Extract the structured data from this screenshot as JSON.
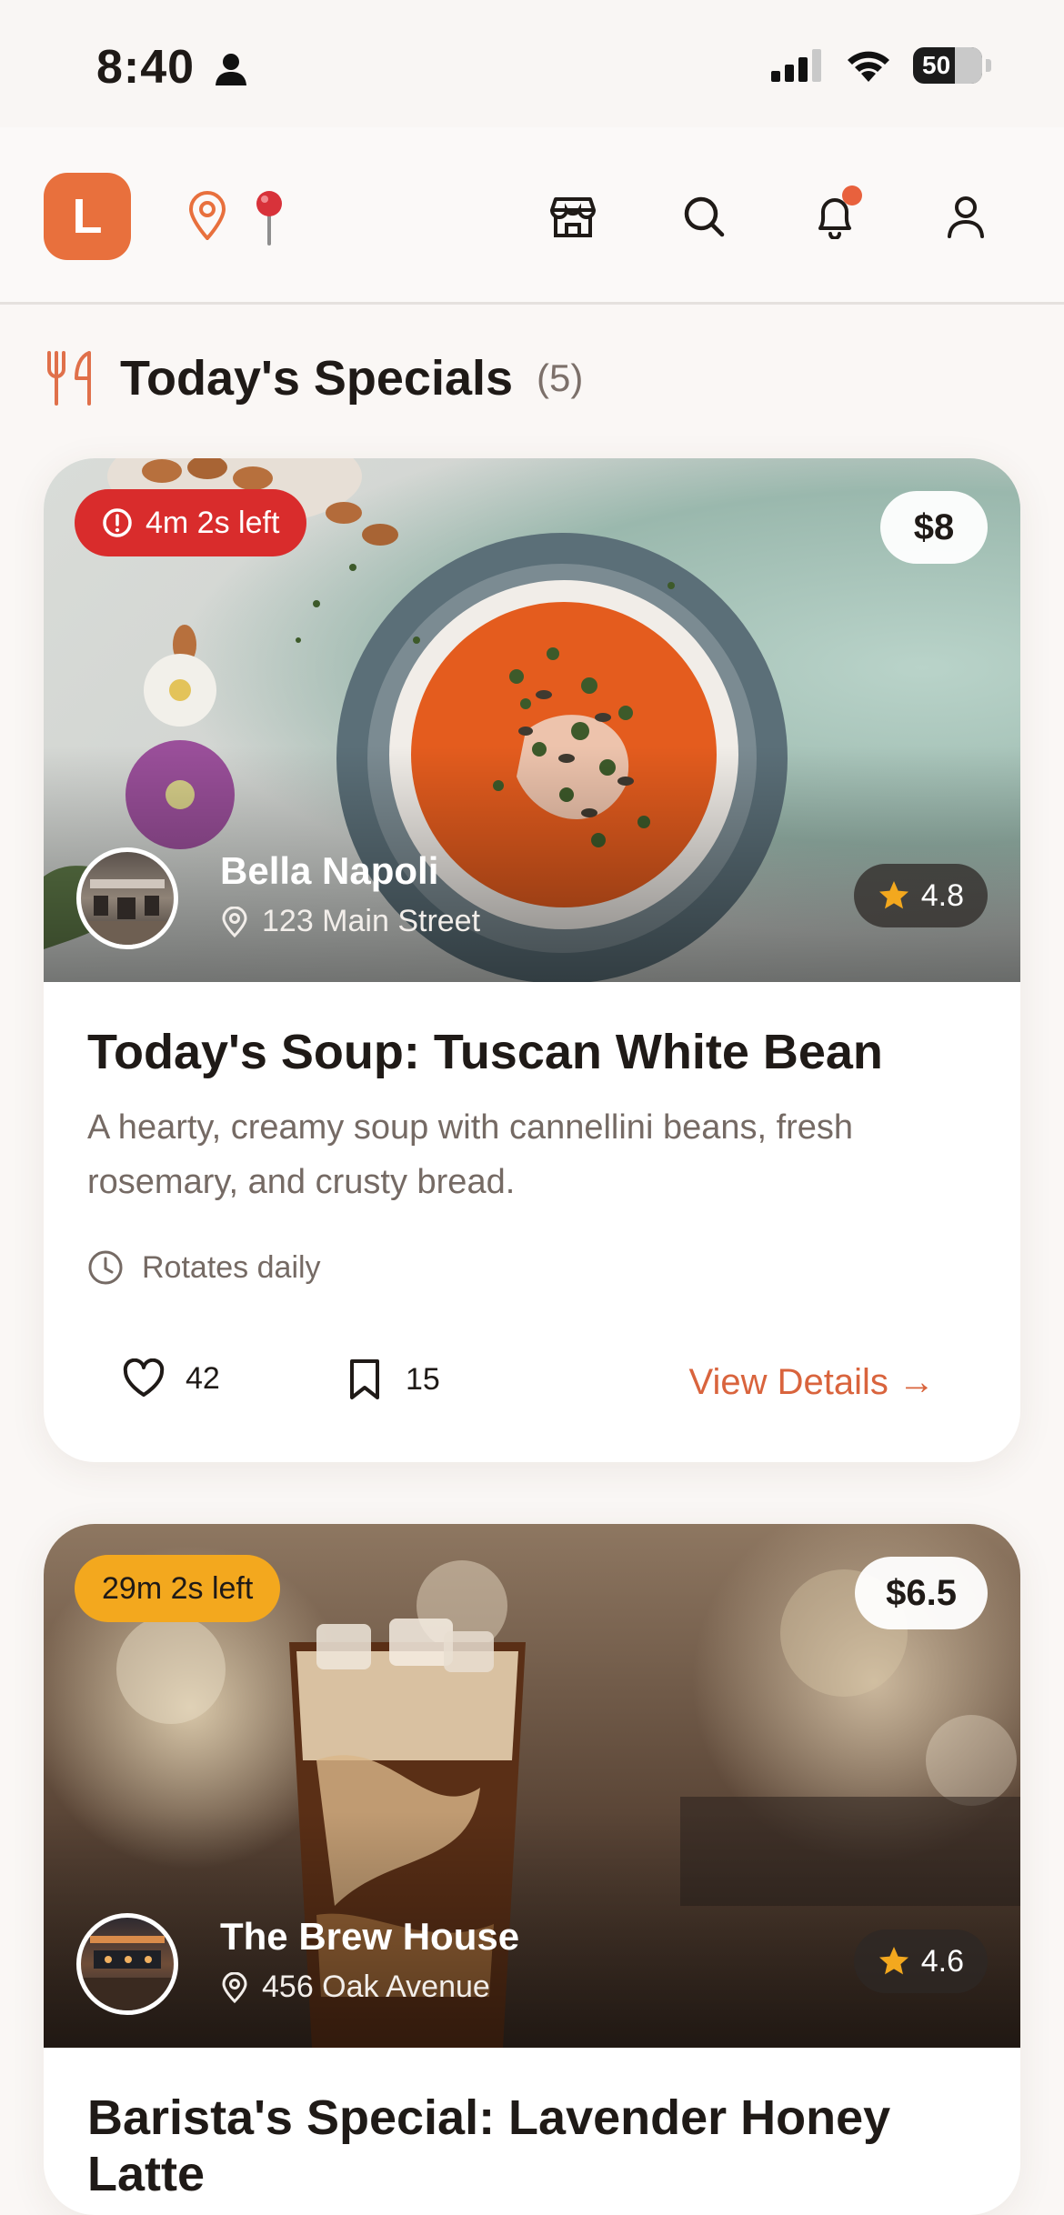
{
  "status_bar": {
    "time": "8:40",
    "battery": "50",
    "icons": [
      "person-icon",
      "signal-icon",
      "wifi-icon",
      "battery-icon"
    ]
  },
  "nav": {
    "logo_letter": "L",
    "icons": [
      "location-outline-icon",
      "location-pin-icon",
      "store-icon",
      "search-icon",
      "bell-icon",
      "user-icon"
    ],
    "accent": "#e8703d"
  },
  "section": {
    "title": "Today's Specials",
    "count": "(5)",
    "icon": "utensils-icon"
  },
  "cards": [
    {
      "timer": "4m 2s left",
      "timer_color": "#d92c2c",
      "price": "$8",
      "restaurant": "Bella Napoli",
      "address": "123 Main Street",
      "rating": "4.8",
      "title": "Today's Soup: Tuscan White Bean",
      "description": "A hearty, creamy soup with cannellini beans, fresh rosemary, and crusty bread.",
      "schedule": "Rotates daily",
      "likes": "42",
      "saves": "15",
      "details_label": "View Details →"
    },
    {
      "timer": "29m 2s left",
      "timer_color": "#f3a81e",
      "price": "$6.5",
      "restaurant": "The Brew House",
      "address": "456 Oak Avenue",
      "rating": "4.6",
      "title": "Barista's Special: Lavender Honey Latte"
    }
  ]
}
